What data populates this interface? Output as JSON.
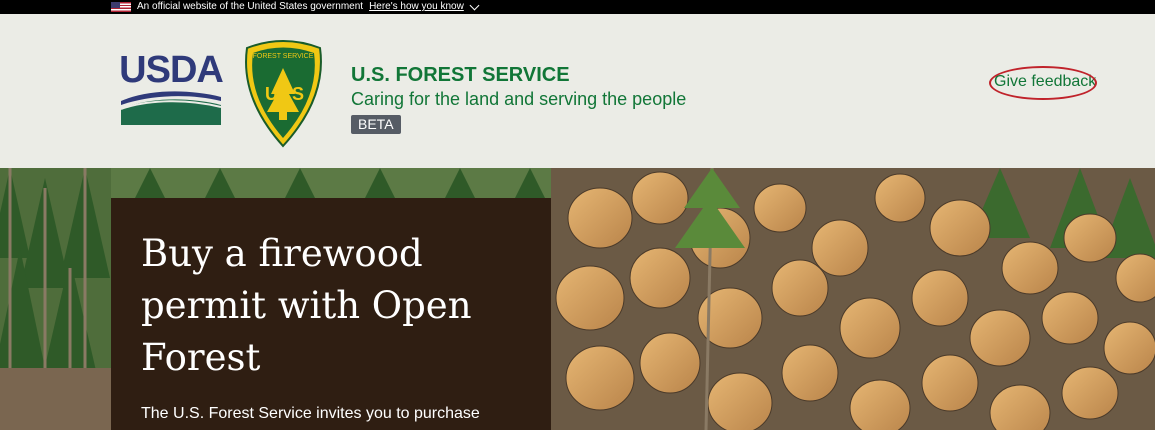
{
  "gov_banner": {
    "text": "An official website of the United States government",
    "link_label": "Here's how you know"
  },
  "header": {
    "usda_text": "USDA",
    "agency_title": "U.S. FOREST SERVICE",
    "tagline": "Caring for the land and serving the people",
    "badge": "BETA",
    "feedback_label": "Give feedback"
  },
  "hero": {
    "title": "Buy a firewood permit with Open Forest",
    "body": "The U.S. Forest Service invites you to purchase"
  },
  "colors": {
    "brand_green": "#117637",
    "header_bg": "#ebece6",
    "panel_brown": "#2f1e12",
    "usda_blue": "#2f3a7a",
    "annotation_red": "#c0232b"
  },
  "icons": [
    "us-flag-icon",
    "chevron-down-icon",
    "usda-logo",
    "forest-service-shield-logo"
  ]
}
